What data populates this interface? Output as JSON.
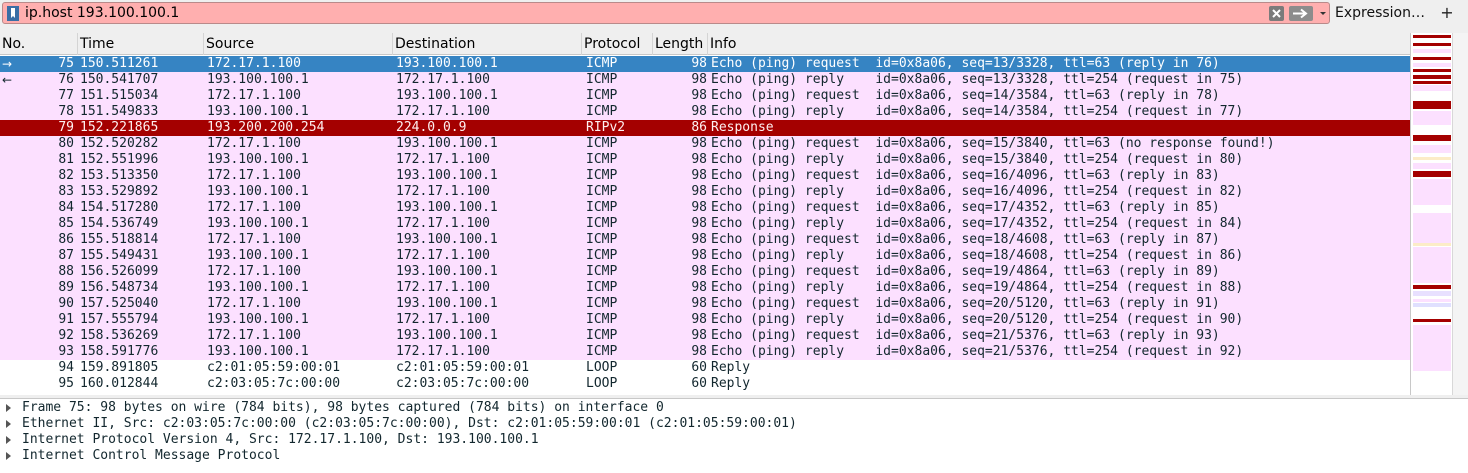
{
  "filter": {
    "value": "ip.host 193.100.100.1",
    "expression_label": "Expression…",
    "add_label": "+"
  },
  "colors": {
    "icmp_bg": "#fce0ff",
    "selected_bg": "#3684c3",
    "selected_fg": "#ffffff",
    "rip_bg": "#a40000",
    "rip_fg": "#fff0f0",
    "other_bg": "#ffffff",
    "filter_bg": "#ffafaf"
  },
  "columns": [
    "No.",
    "Time",
    "Source",
    "Destination",
    "Protocol",
    "Length",
    "Info"
  ],
  "packets": [
    {
      "no": "75",
      "time": "150.511261",
      "src": "172.17.1.100",
      "dst": "193.100.100.1",
      "proto": "ICMP",
      "len": "98",
      "info": "Echo (ping) request  id=0x8a06, seq=13/3328, ttl=63 (reply in 76)",
      "style": "selected",
      "marker": "→"
    },
    {
      "no": "76",
      "time": "150.541707",
      "src": "193.100.100.1",
      "dst": "172.17.1.100",
      "proto": "ICMP",
      "len": "98",
      "info": "Echo (ping) reply    id=0x8a06, seq=13/3328, ttl=254 (request in 75)",
      "style": "icmp",
      "marker": "←"
    },
    {
      "no": "77",
      "time": "151.515034",
      "src": "172.17.1.100",
      "dst": "193.100.100.1",
      "proto": "ICMP",
      "len": "98",
      "info": "Echo (ping) request  id=0x8a06, seq=14/3584, ttl=63 (reply in 78)",
      "style": "icmp",
      "marker": ""
    },
    {
      "no": "78",
      "time": "151.549833",
      "src": "193.100.100.1",
      "dst": "172.17.1.100",
      "proto": "ICMP",
      "len": "98",
      "info": "Echo (ping) reply    id=0x8a06, seq=14/3584, ttl=254 (request in 77)",
      "style": "icmp",
      "marker": ""
    },
    {
      "no": "79",
      "time": "152.221865",
      "src": "193.200.200.254",
      "dst": "224.0.0.9",
      "proto": "RIPv2",
      "len": "86",
      "info": "Response",
      "style": "rip",
      "marker": ""
    },
    {
      "no": "80",
      "time": "152.520282",
      "src": "172.17.1.100",
      "dst": "193.100.100.1",
      "proto": "ICMP",
      "len": "98",
      "info": "Echo (ping) request  id=0x8a06, seq=15/3840, ttl=63 (no response found!)",
      "style": "icmp",
      "marker": ""
    },
    {
      "no": "81",
      "time": "152.551996",
      "src": "193.100.100.1",
      "dst": "172.17.1.100",
      "proto": "ICMP",
      "len": "98",
      "info": "Echo (ping) reply    id=0x8a06, seq=15/3840, ttl=254 (request in 80)",
      "style": "icmp",
      "marker": ""
    },
    {
      "no": "82",
      "time": "153.513350",
      "src": "172.17.1.100",
      "dst": "193.100.100.1",
      "proto": "ICMP",
      "len": "98",
      "info": "Echo (ping) request  id=0x8a06, seq=16/4096, ttl=63 (reply in 83)",
      "style": "icmp",
      "marker": ""
    },
    {
      "no": "83",
      "time": "153.529892",
      "src": "193.100.100.1",
      "dst": "172.17.1.100",
      "proto": "ICMP",
      "len": "98",
      "info": "Echo (ping) reply    id=0x8a06, seq=16/4096, ttl=254 (request in 82)",
      "style": "icmp",
      "marker": ""
    },
    {
      "no": "84",
      "time": "154.517280",
      "src": "172.17.1.100",
      "dst": "193.100.100.1",
      "proto": "ICMP",
      "len": "98",
      "info": "Echo (ping) request  id=0x8a06, seq=17/4352, ttl=63 (reply in 85)",
      "style": "icmp",
      "marker": ""
    },
    {
      "no": "85",
      "time": "154.536749",
      "src": "193.100.100.1",
      "dst": "172.17.1.100",
      "proto": "ICMP",
      "len": "98",
      "info": "Echo (ping) reply    id=0x8a06, seq=17/4352, ttl=254 (request in 84)",
      "style": "icmp",
      "marker": ""
    },
    {
      "no": "86",
      "time": "155.518814",
      "src": "172.17.1.100",
      "dst": "193.100.100.1",
      "proto": "ICMP",
      "len": "98",
      "info": "Echo (ping) request  id=0x8a06, seq=18/4608, ttl=63 (reply in 87)",
      "style": "icmp",
      "marker": ""
    },
    {
      "no": "87",
      "time": "155.549431",
      "src": "193.100.100.1",
      "dst": "172.17.1.100",
      "proto": "ICMP",
      "len": "98",
      "info": "Echo (ping) reply    id=0x8a06, seq=18/4608, ttl=254 (request in 86)",
      "style": "icmp",
      "marker": ""
    },
    {
      "no": "88",
      "time": "156.526099",
      "src": "172.17.1.100",
      "dst": "193.100.100.1",
      "proto": "ICMP",
      "len": "98",
      "info": "Echo (ping) request  id=0x8a06, seq=19/4864, ttl=63 (reply in 89)",
      "style": "icmp",
      "marker": ""
    },
    {
      "no": "89",
      "time": "156.548734",
      "src": "193.100.100.1",
      "dst": "172.17.1.100",
      "proto": "ICMP",
      "len": "98",
      "info": "Echo (ping) reply    id=0x8a06, seq=19/4864, ttl=254 (request in 88)",
      "style": "icmp",
      "marker": ""
    },
    {
      "no": "90",
      "time": "157.525040",
      "src": "172.17.1.100",
      "dst": "193.100.100.1",
      "proto": "ICMP",
      "len": "98",
      "info": "Echo (ping) request  id=0x8a06, seq=20/5120, ttl=63 (reply in 91)",
      "style": "icmp",
      "marker": ""
    },
    {
      "no": "91",
      "time": "157.555794",
      "src": "193.100.100.1",
      "dst": "172.17.1.100",
      "proto": "ICMP",
      "len": "98",
      "info": "Echo (ping) reply    id=0x8a06, seq=20/5120, ttl=254 (request in 90)",
      "style": "icmp",
      "marker": ""
    },
    {
      "no": "92",
      "time": "158.536269",
      "src": "172.17.1.100",
      "dst": "193.100.100.1",
      "proto": "ICMP",
      "len": "98",
      "info": "Echo (ping) request  id=0x8a06, seq=21/5376, ttl=63 (reply in 93)",
      "style": "icmp",
      "marker": ""
    },
    {
      "no": "93",
      "time": "158.591776",
      "src": "193.100.100.1",
      "dst": "172.17.1.100",
      "proto": "ICMP",
      "len": "98",
      "info": "Echo (ping) reply    id=0x8a06, seq=21/5376, ttl=254 (request in 92)",
      "style": "icmp",
      "marker": ""
    },
    {
      "no": "94",
      "time": "159.891805",
      "src": "c2:01:05:59:00:01",
      "dst": "c2:01:05:59:00:01",
      "proto": "LOOP",
      "len": "60",
      "info": "Reply",
      "style": "other",
      "marker": ""
    },
    {
      "no": "95",
      "time": "160.012844",
      "src": "c2:03:05:7c:00:00",
      "dst": "c2:03:05:7c:00:00",
      "proto": "LOOP",
      "len": "60",
      "info": "Reply",
      "style": "other",
      "marker": ""
    }
  ],
  "details": [
    "Frame 75: 98 bytes on wire (784 bits), 98 bytes captured (784 bits) on interface 0",
    "Ethernet II, Src: c2:03:05:7c:00:00 (c2:03:05:7c:00:00), Dst: c2:01:05:59:00:01 (c2:01:05:59:00:01)",
    "Internet Protocol Version 4, Src: 172.17.1.100, Dst: 193.100.100.1",
    "Internet Control Message Protocol"
  ]
}
